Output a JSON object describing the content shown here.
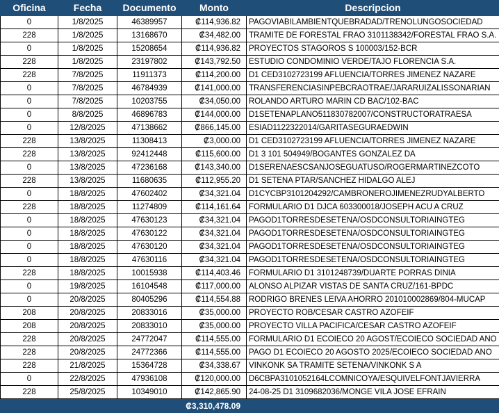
{
  "headers": [
    "Oficina",
    "Fecha",
    "Documento",
    "Monto",
    "Descripcion"
  ],
  "rows": [
    [
      "0",
      "1/8/2025",
      "46389957",
      "₡114,936.82",
      "PAGOVIABILAMBIENTQUEBRADAD/TRENOLUNGOSOCIEDAD"
    ],
    [
      "228",
      "1/8/2025",
      "13168670",
      "₡34,482.00",
      "TRAMITE DE FORESTAL FRAO 3101138342/FORESTAL FRAO S.A."
    ],
    [
      "0",
      "1/8/2025",
      "15208654",
      "₡114,936.82",
      "PROYECTOS STAGOROS S 100003/152-BCR"
    ],
    [
      "228",
      "1/8/2025",
      "23197802",
      "₡143,792.50",
      "ESTUDIO CONDOMINIO VERDE/TAJO FLORENCIA S.A."
    ],
    [
      "228",
      "7/8/2025",
      "11911373",
      "₡114,200.00",
      "D1 CED3102723199 AFLUENCIA/TORRES JIMENEZ NAZARE"
    ],
    [
      "0",
      "7/8/2025",
      "46784939",
      "₡141,000.00",
      "TRANSFERENCIASINPEBCRAOTRAE/JARARUIZALISSONARIAN"
    ],
    [
      "0",
      "7/8/2025",
      "10203755",
      "₡34,050.00",
      "ROLANDO ARTURO MARIN CD BAC/102-BAC"
    ],
    [
      "0",
      "8/8/2025",
      "46896783",
      "₡144,000.00",
      "D1SETENAPLANO511830782007/CONSTRUCTORATRAESA"
    ],
    [
      "0",
      "12/8/2025",
      "47138662",
      "₡866,145.00",
      "ESIAD1122322014/GARITASEGURAEDWIN"
    ],
    [
      "228",
      "13/8/2025",
      "11308413",
      "₡3,000.00",
      "D1 CED3102723199 AFLUENCIA/TORRES JIMENEZ NAZARE"
    ],
    [
      "228",
      "13/8/2025",
      "92412448",
      "₡115,600.00",
      "D1 3 101 504949/BOGANTES GONZALEZ DA"
    ],
    [
      "0",
      "13/8/2025",
      "47236168",
      "₡143,340.00",
      "D1SERENAESCSANJOSEGUATUSO/ROGERMARTINEZCOTO"
    ],
    [
      "228",
      "13/8/2025",
      "11680635",
      "₡112,955.20",
      "D1 SETENA PTAR/SANCHEZ HIDALGO ALEJ"
    ],
    [
      "0",
      "18/8/2025",
      "47602402",
      "₡34,321.04",
      "D1CYCBP3101204292/CAMBRONEROJIMENEZRUDYALBERTO"
    ],
    [
      "228",
      "18/8/2025",
      "11274809",
      "₡114,161.64",
      "FORMULARIO D1 DJCA 603300018/JOSEPH ACU A CRUZ"
    ],
    [
      "0",
      "18/8/2025",
      "47630123",
      "₡34,321.04",
      "PAGOD1TORRESDESETENA/OSDCONSULTORIAINGTEG"
    ],
    [
      "0",
      "18/8/2025",
      "47630122",
      "₡34,321.04",
      "PAGOD1TORRESDESETENA/OSDCONSULTORIAINGTEG"
    ],
    [
      "0",
      "18/8/2025",
      "47630120",
      "₡34,321.04",
      "PAGOD1TORRESDESETENA/OSDCONSULTORIAINGTEG"
    ],
    [
      "0",
      "18/8/2025",
      "47630116",
      "₡34,321.04",
      "PAGOD1TORRESDESETENA/OSDCONSULTORIAINGTEG"
    ],
    [
      "228",
      "18/8/2025",
      "10015938",
      "₡114,403.46",
      "FORMULARIO D1 3101248739/DUARTE PORRAS DINIA"
    ],
    [
      "0",
      "19/8/2025",
      "16104548",
      "₡117,000.00",
      "ALONSO ALPIZAR VISTAS DE SANTA CRUZ/161-BPDC"
    ],
    [
      "0",
      "20/8/2025",
      "80405296",
      "₡114,554.88",
      "RODRIGO BRENES LEIVA AHORRO 201010002869/804-MUCAP"
    ],
    [
      "208",
      "20/8/2025",
      "20833016",
      "₡35,000.00",
      "PROYECTO ROB/CESAR CASTRO AZOFEIF"
    ],
    [
      "208",
      "20/8/2025",
      "20833010",
      "₡35,000.00",
      "PROYECTO VILLA PACIFICA/CESAR CASTRO AZOFEIF"
    ],
    [
      "228",
      "20/8/2025",
      "24772047",
      "₡114,555.00",
      "FORMULARIO D1 ECOIECO 20 AGOST/ECOIECO SOCIEDAD ANO"
    ],
    [
      "228",
      "20/8/2025",
      "24772366",
      "₡114,555.00",
      "PAGO D1 ECOIECO 20 AGOSTO 2025/ECOIECO SOCIEDAD ANO"
    ],
    [
      "228",
      "21/8/2025",
      "15364728",
      "₡34,338.67",
      "VINKONK SA TRAMITE SETENA/VINKONK S A"
    ],
    [
      "0",
      "22/8/2025",
      "47936108",
      "₡120,000.00",
      "D6CBPA3101052164LCOMNICOYA/ESQUIVELFONTJAVIERRA"
    ],
    [
      "228",
      "25/8/2025",
      "10349010",
      "₡142,865.90",
      "24-08-25 D1 3109682036/MONGE VILA JOSE EFRAIN"
    ]
  ],
  "total": "₡3,310,478.09"
}
